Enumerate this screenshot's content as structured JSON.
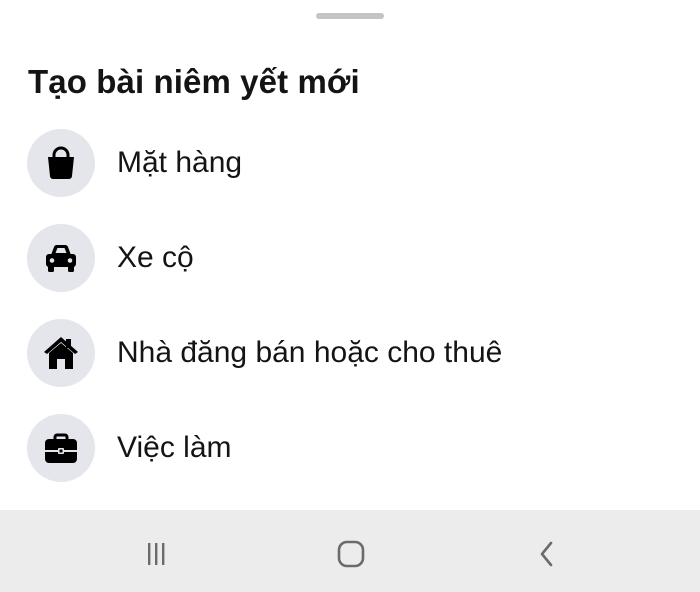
{
  "sheet": {
    "title": "Tạo bài niêm yết mới",
    "items": [
      {
        "label": "Mặt hàng",
        "icon": "shopping-bag-icon"
      },
      {
        "label": "Xe cộ",
        "icon": "car-icon"
      },
      {
        "label": "Nhà đăng bán hoặc cho thuê",
        "icon": "house-icon"
      },
      {
        "label": "Việc làm",
        "icon": "briefcase-icon"
      }
    ]
  },
  "navbar": {
    "recent_icon": "recent-apps-icon",
    "home_icon": "home-button-icon",
    "back_icon": "back-icon"
  },
  "colors": {
    "sheet_background": "#ffffff",
    "icon_circle": "#e4e6eb",
    "text": "#141414",
    "navbar_background": "#ececec",
    "grabber": "#c4c4c7"
  }
}
